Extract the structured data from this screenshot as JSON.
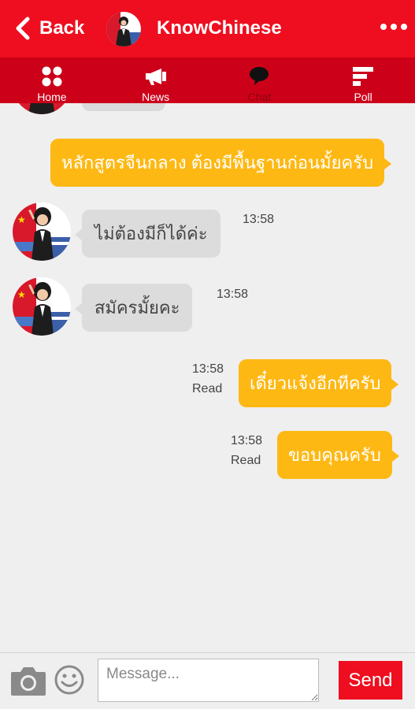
{
  "header": {
    "back_label": "Back",
    "title": "KnowChinese",
    "back_icon": "chevron-left-icon",
    "menu_icon": "more-dots-icon",
    "bg_color": "#ee0e1f"
  },
  "tabs": [
    {
      "label": "Home",
      "icon": "home-grid-icon"
    },
    {
      "label": "News",
      "icon": "megaphone-icon"
    },
    {
      "label": "Chat",
      "icon": "speech-bubble-icon",
      "active": true
    },
    {
      "label": "Poll",
      "icon": "poll-bars-icon"
    }
  ],
  "messages": [
    {
      "from": "me",
      "text": "หลักสูตรจีนกลาง ต้องมีพื้นฐานก่อนมั้ยครับ"
    },
    {
      "from": "them",
      "text": "ไม่ต้องมีก็ได้ค่ะ",
      "time": "13:58"
    },
    {
      "from": "them",
      "text": "สมัครมั้ยคะ",
      "time": "13:58"
    },
    {
      "from": "me",
      "text": "เดี๋ยวแจ้งอีกทีครับ",
      "time": "13:58",
      "status": "Read"
    },
    {
      "from": "me",
      "text": "ขอบคุณครับ",
      "time": "13:58",
      "status": "Read"
    }
  ],
  "composer": {
    "placeholder": "Message...",
    "value": "",
    "send_label": "Send",
    "camera_icon": "camera-icon",
    "emoji_icon": "smiley-icon"
  },
  "colors": {
    "brand_red": "#ee0e1f",
    "tab_red": "#cc0019",
    "my_bubble": "#fdb813",
    "their_bubble": "#dcdcdc"
  }
}
